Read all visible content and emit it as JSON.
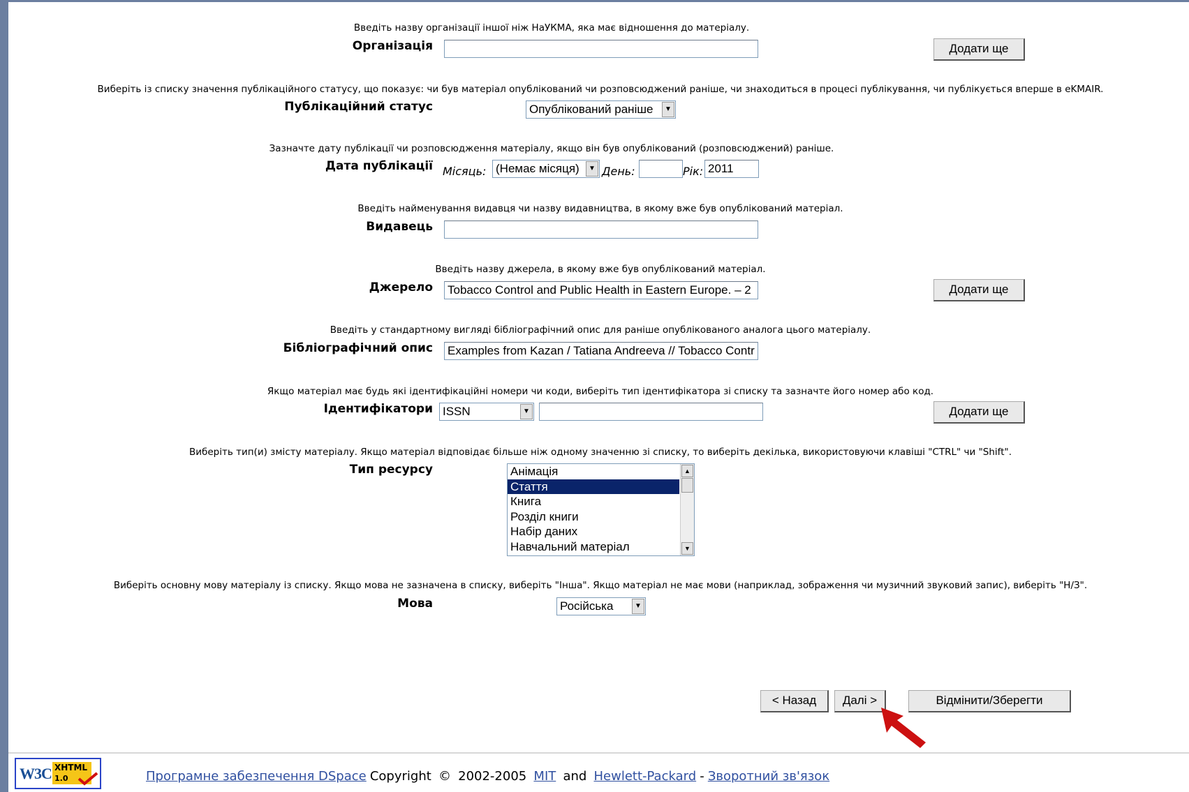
{
  "organization": {
    "hint": "Введіть назву організації іншої ніж НаУКМА, яка має відношення до матеріалу.",
    "label": "Організація",
    "value": "",
    "add_label": "Додати ще"
  },
  "pub_status": {
    "hint": "Виберіть із списку значення публікаційного статусу, що показує: чи був матеріал опублікований чи розповсюджений раніше, чи знаходиться в процесі публікування, чи публікується вперше в eKMAIR.",
    "label": "Публікаційний статус",
    "selected": "Опублікований раніше"
  },
  "pub_date": {
    "hint": "Зазначте дату публікації чи розповсюдження матеріалу, якщо він був опублікований (розповсюджений) раніше.",
    "label": "Дата публікації",
    "month_label": "Місяць:",
    "month_selected": "(Немає місяця)",
    "day_label": "День:",
    "day_value": "",
    "year_label": "Рік:",
    "year_value": "2011"
  },
  "publisher": {
    "hint": "Введіть найменування видавця чи назву видавництва, в якому вже був опублікований матеріал.",
    "label": "Видавець",
    "value": ""
  },
  "source": {
    "hint": "Введіть назву джерела, в якому вже був опублікований матеріал.",
    "label": "Джерело",
    "value": "Tobacco Control and Public Health in Eastern Europe. – 2",
    "add_label": "Додати ще"
  },
  "citation": {
    "hint": "Введіть у стандартному вигляді бібліографічний опис для раніше опублікованого аналога цього матеріалу.",
    "label": "Бібліографічний опис",
    "value": "Examples from Kazan / Tatiana Andreeva // Tobacco Contr"
  },
  "identifiers": {
    "hint": "Якщо матеріал має будь які ідентифікаційні номери чи коди, виберіть тип ідентифікатора зі списку та зазначте його номер або код.",
    "label": "Ідентифікатори",
    "type_selected": "ISSN",
    "value": "",
    "add_label": "Додати ще"
  },
  "resource_type": {
    "hint": "Виберіть тип(и) змісту матеріалу. Якщо матеріал відповідає більше ніж одному значенню зі списку, то виберіть декілька, використовуючи клавіші \"CTRL\" чи \"Shift\".",
    "label": "Тип ресурсу",
    "options": [
      "Анімація",
      "Стаття",
      "Книга",
      "Розділ книги",
      "Набір даних",
      "Навчальний матеріал"
    ],
    "selected_index": 1
  },
  "language": {
    "hint": "Виберіть основну мову матеріалу із списку. Якщо мова не зазначена в списку, виберіть \"Інша\". Якщо матеріал не має мови (наприклад, зображення чи музичний звуковий запис), виберіть \"Н/З\".",
    "label": "Мова",
    "selected": "Російська"
  },
  "nav": {
    "back_label": "< Назад",
    "next_label": "Далі >",
    "cancel_label": "Відмінити/Зберегти"
  },
  "footer": {
    "badge_w3c": "W3C",
    "badge_xhtml": "XHTML",
    "badge_version": "1.0",
    "software_link": "Програмне забезпечення DSpace",
    "copyright": "Copyright",
    "symbol": "©",
    "years": "2002-2005",
    "mit_link": "MIT",
    "and": "and",
    "hp_link": "Hewlett-Packard",
    "dash": "-",
    "feedback_link": "Зворотний зв'язок"
  },
  "colors": {
    "frame": "#6c7fa0",
    "selection": "#0a246a",
    "link": "#3050a0",
    "pointer": "#cc1111"
  }
}
